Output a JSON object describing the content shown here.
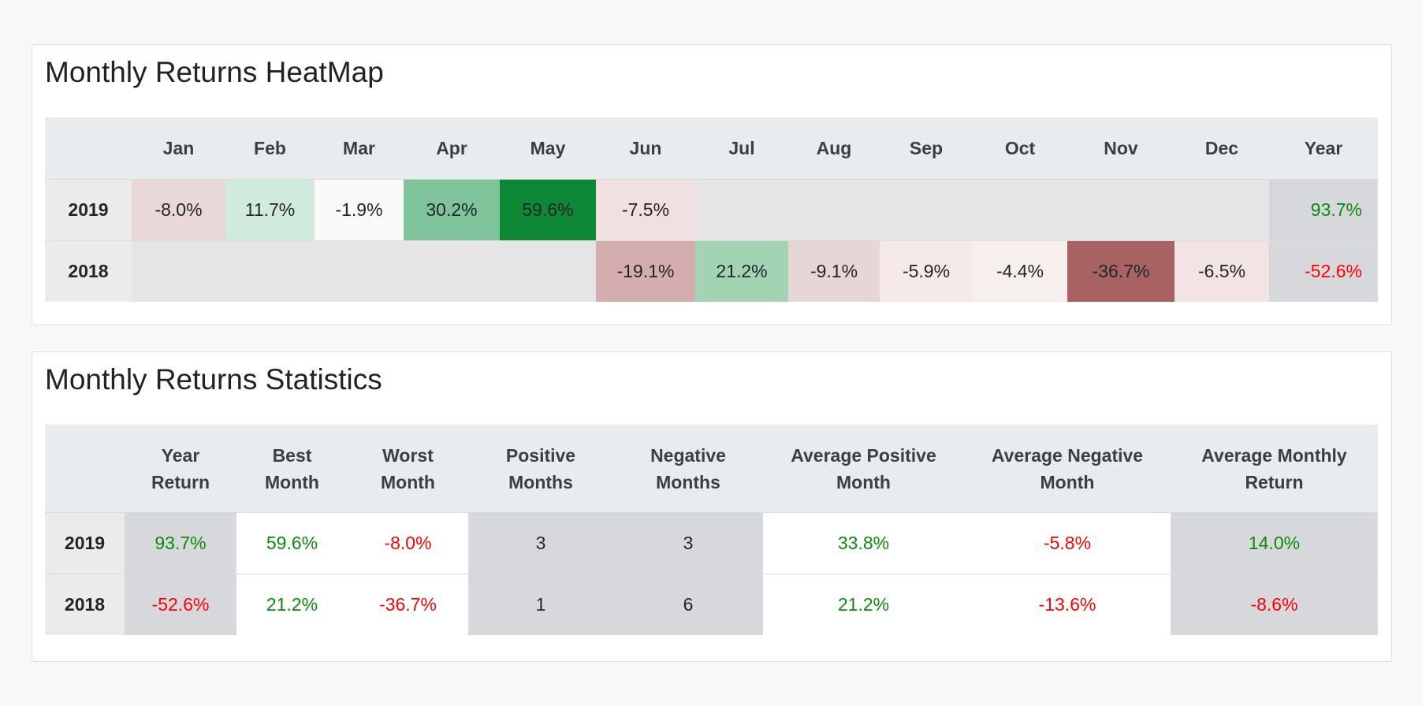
{
  "heatmap": {
    "title": "Monthly Returns HeatMap",
    "columns": [
      "Jan",
      "Feb",
      "Mar",
      "Apr",
      "May",
      "Jun",
      "Jul",
      "Aug",
      "Sep",
      "Oct",
      "Nov",
      "Dec"
    ],
    "year_label": "Year",
    "rows": [
      {
        "year": "2019",
        "cells": [
          {
            "text": "-8.0%",
            "bg": "#e8d8d8"
          },
          {
            "text": "11.7%",
            "bg": "#d0eadb"
          },
          {
            "text": "-1.9%",
            "bg": "#fbf8f8"
          },
          {
            "text": "30.2%",
            "bg": "#7fc39a"
          },
          {
            "text": "59.6%",
            "bg": "#0e8737"
          },
          {
            "text": "-7.5%",
            "bg": "#f0e0e0"
          },
          {
            "text": "",
            "bg": "#e5e5e5"
          },
          {
            "text": "",
            "bg": "#e5e5e5"
          },
          {
            "text": "",
            "bg": "#e5e5e5"
          },
          {
            "text": "",
            "bg": "#e5e5e5"
          },
          {
            "text": "",
            "bg": "#e5e5e5"
          },
          {
            "text": "",
            "bg": "#e5e5e5"
          }
        ],
        "year_return": {
          "text": "93.7%",
          "color": "#0a8a0a"
        }
      },
      {
        "year": "2018",
        "cells": [
          {
            "text": "",
            "bg": "#e5e5e5"
          },
          {
            "text": "",
            "bg": "#e5e5e5"
          },
          {
            "text": "",
            "bg": "#e5e5e5"
          },
          {
            "text": "",
            "bg": "#e5e5e5"
          },
          {
            "text": "",
            "bg": "#e5e5e5"
          },
          {
            "text": "-19.1%",
            "bg": "#d4aeae"
          },
          {
            "text": "21.2%",
            "bg": "#a2d3b3"
          },
          {
            "text": "-9.1%",
            "bg": "#e7d6d6"
          },
          {
            "text": "-5.9%",
            "bg": "#f5e9e9"
          },
          {
            "text": "-4.4%",
            "bg": "#f7eeee"
          },
          {
            "text": "-36.7%",
            "bg": "#a86262"
          },
          {
            "text": "-6.5%",
            "bg": "#f2e4e4"
          }
        ],
        "year_return": {
          "text": "-52.6%",
          "color": "#ff0000"
        }
      }
    ],
    "year_col_bg": "#d7d8db"
  },
  "stats": {
    "title": "Monthly Returns Statistics",
    "columns": [
      {
        "line1": "Year",
        "line2": "Return"
      },
      {
        "line1": "Best",
        "line2": "Month"
      },
      {
        "line1": "Worst",
        "line2": "Month"
      },
      {
        "line1": "Positive",
        "line2": "Months"
      },
      {
        "line1": "Negative",
        "line2": "Months"
      },
      {
        "line1": "Average Positive",
        "line2": "Month"
      },
      {
        "line1": "Average Negative",
        "line2": "Month"
      },
      {
        "line1": "Average Monthly",
        "line2": "Return"
      }
    ],
    "rows": [
      {
        "year": "2019",
        "values": [
          {
            "text": "93.7%",
            "sign": "pos"
          },
          {
            "text": "59.6%",
            "sign": "pos"
          },
          {
            "text": "-8.0%",
            "sign": "neg"
          },
          {
            "text": "3",
            "sign": "neu"
          },
          {
            "text": "3",
            "sign": "neu"
          },
          {
            "text": "33.8%",
            "sign": "pos"
          },
          {
            "text": "-5.8%",
            "sign": "neg"
          },
          {
            "text": "14.0%",
            "sign": "pos"
          }
        ]
      },
      {
        "year": "2018",
        "values": [
          {
            "text": "-52.6%",
            "sign": "neg"
          },
          {
            "text": "21.2%",
            "sign": "pos"
          },
          {
            "text": "-36.7%",
            "sign": "neg"
          },
          {
            "text": "1",
            "sign": "neu"
          },
          {
            "text": "6",
            "sign": "neu"
          },
          {
            "text": "21.2%",
            "sign": "pos"
          },
          {
            "text": "-13.6%",
            "sign": "neg"
          },
          {
            "text": "-8.6%",
            "sign": "neg"
          }
        ]
      }
    ]
  },
  "colors": {
    "positive_text": "#0a8a0a",
    "negative_text": "#ff0000",
    "header_bg": "#e9ecef",
    "shaded_column_bg": "#d7d8db"
  }
}
